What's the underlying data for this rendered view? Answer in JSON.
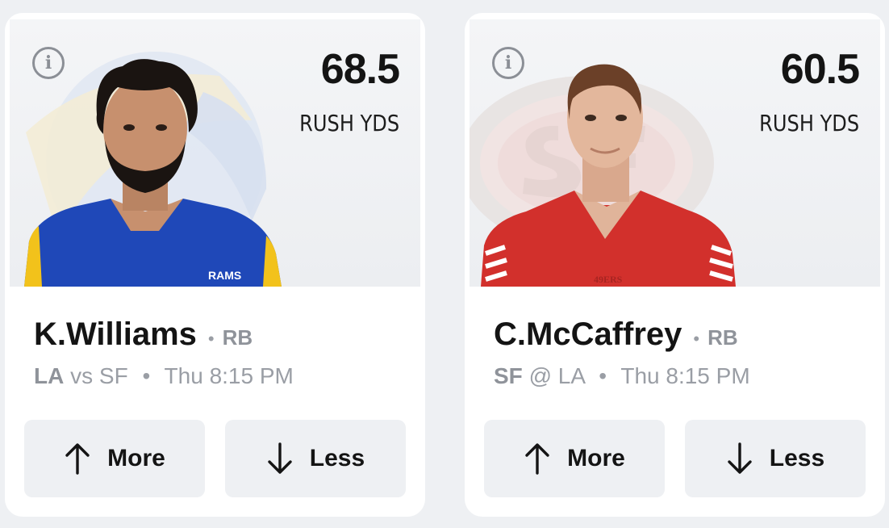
{
  "cards": [
    {
      "line_value": "68.5",
      "stat_label": "RUSH YDS",
      "player_name": "K.Williams",
      "position": "RB",
      "team": "LA",
      "matchup_rest": "vs SF",
      "game_time": "Thu 8:15 PM",
      "more_label": "More",
      "less_label": "Less",
      "info_glyph": "i",
      "jersey_color": "#1f48b8",
      "accent_color": "#f2c21b"
    },
    {
      "line_value": "60.5",
      "stat_label": "RUSH YDS",
      "player_name": "C.McCaffrey",
      "position": "RB",
      "team": "SF",
      "matchup_rest": "@ LA",
      "game_time": "Thu 8:15 PM",
      "more_label": "More",
      "less_label": "Less",
      "info_glyph": "i",
      "jersey_color": "#d2302c",
      "accent_color": "#ffffff"
    }
  ],
  "separator": "•",
  "jersey_texts": [
    "RAMS",
    "49ERS"
  ],
  "icons": {
    "info": "info-icon",
    "more": "arrow-up-icon",
    "less": "arrow-down-icon"
  }
}
